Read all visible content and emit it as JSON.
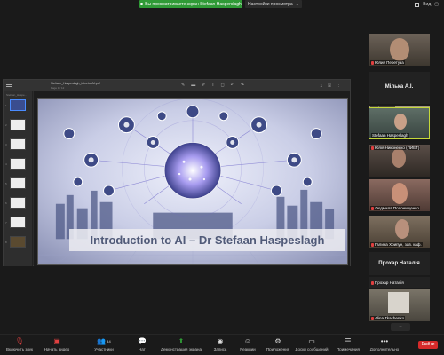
{
  "topbar": {
    "share_notice": "Вы просматриваете экран Stefaan Hasperslagh",
    "view_options": "Настройки просмотра",
    "view_label": "Вид"
  },
  "document": {
    "title": "Stefaan_Haspeslagh_intro-to-AI.pdf",
    "pages": "Page 1 / 12",
    "thumbs_label": "Stefaan_Haspe...",
    "thumbnails": [
      {
        "num": "1",
        "active": true
      },
      {
        "num": "2",
        "active": false
      },
      {
        "num": "3",
        "active": false
      },
      {
        "num": "4",
        "active": false
      },
      {
        "num": "5",
        "active": false
      },
      {
        "num": "6",
        "active": false
      },
      {
        "num": "7",
        "active": false
      },
      {
        "num": "8",
        "active": false
      }
    ],
    "slide_title": "Introduction to AI – Dr Stefaan Haspeslagh"
  },
  "participants": [
    {
      "name": "Юлия Перетуза",
      "type": "video",
      "bg": "#6c6258"
    },
    {
      "name": "Мілька А.І.",
      "type": "text"
    },
    {
      "name": "Мілька А.І.",
      "type": "video",
      "bg": "#8a7f6a"
    },
    {
      "name": "Stefaan Haspeslagh",
      "type": "video",
      "bg": "#4e5e58",
      "active": true
    },
    {
      "name": "Юлія Никоненко (ПИЕТ)",
      "type": "video",
      "bg": "#5a4e48"
    },
    {
      "name": "Людмила Полонищенко",
      "type": "video",
      "bg": "#7a5a52"
    },
    {
      "name": "Галина Хрипун, зав. каф.",
      "type": "video",
      "bg": "#6e6052"
    },
    {
      "name": "Прохар Наталія",
      "type": "text"
    },
    {
      "name": "Прохар Наталія",
      "type": "video",
      "bg": "#2a2a2a"
    },
    {
      "name": "Alina Tkachenko",
      "type": "video",
      "bg": "#6a6458"
    }
  ],
  "toolbar": {
    "audio": "Включить звук",
    "video": "Начать видео",
    "participants": "Участники",
    "participants_count": "44",
    "chat": "Чат",
    "share": "Демонстрация экрана",
    "record": "Запись",
    "reactions": "Реакции",
    "apps": "Приложения",
    "whiteboard": "Доски сообщений",
    "notes": "Примечания",
    "more": "Дополнительно",
    "end": "Выйти"
  }
}
